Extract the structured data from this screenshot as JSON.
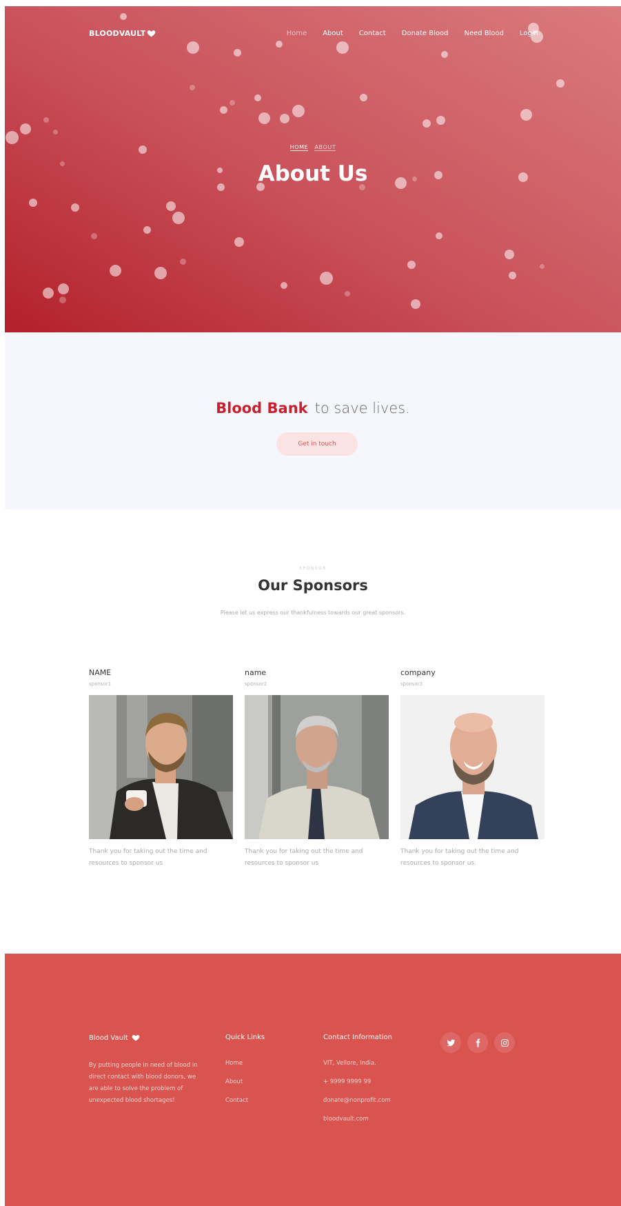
{
  "nav": {
    "brand": "BLOODVAULT",
    "links": [
      {
        "label": "Home",
        "active": true
      },
      {
        "label": "About",
        "active": false
      },
      {
        "label": "Contact",
        "active": false
      },
      {
        "label": "Donate Blood",
        "active": false
      },
      {
        "label": "Need Blood",
        "active": false
      },
      {
        "label": "Login",
        "active": false
      }
    ]
  },
  "hero": {
    "breadcrumb": [
      "HOME",
      "ABOUT"
    ],
    "title": "About Us"
  },
  "cta": {
    "strong": "Blood Bank",
    "rest": "to save lives.",
    "button": "Get in touch"
  },
  "sponsors": {
    "eyebrow": "SPONSOR",
    "title": "Our Sponsors",
    "subtitle": "Please let us express our thankfulness towards our great sponsors.",
    "cards": [
      {
        "name": "NAME",
        "handle": "sponsor1",
        "text": "Thank you for taking out the time and resources to sponsor us"
      },
      {
        "name": "name",
        "handle": "sponsor2",
        "text": "Thank you for taking out the time and resources to sponsor us"
      },
      {
        "name": "company",
        "handle": "sponsor3",
        "text": "Thank you for taking out the time and resources to sponsor us."
      }
    ]
  },
  "footer": {
    "brand": "Blood Vault",
    "about": "By putting people in need of blood in direct contact with blood donors, we are able to solve the problem of unexpected blood shortages!",
    "quick_title": "Quick Links",
    "quick_links": [
      "Home",
      "About",
      "Contact"
    ],
    "contact_title": "Contact Information",
    "contact": [
      "VIT, Vellore, India.",
      "+ 9999 9999 99",
      "donate@nonprofit.com",
      "bloodvault.com"
    ],
    "socials": [
      "twitter-icon",
      "facebook-icon",
      "instagram-icon"
    ]
  },
  "colors": {
    "brand_red": "#c5212f",
    "footer_red": "#d9534f",
    "cta_bg": "#f6f7fc"
  }
}
